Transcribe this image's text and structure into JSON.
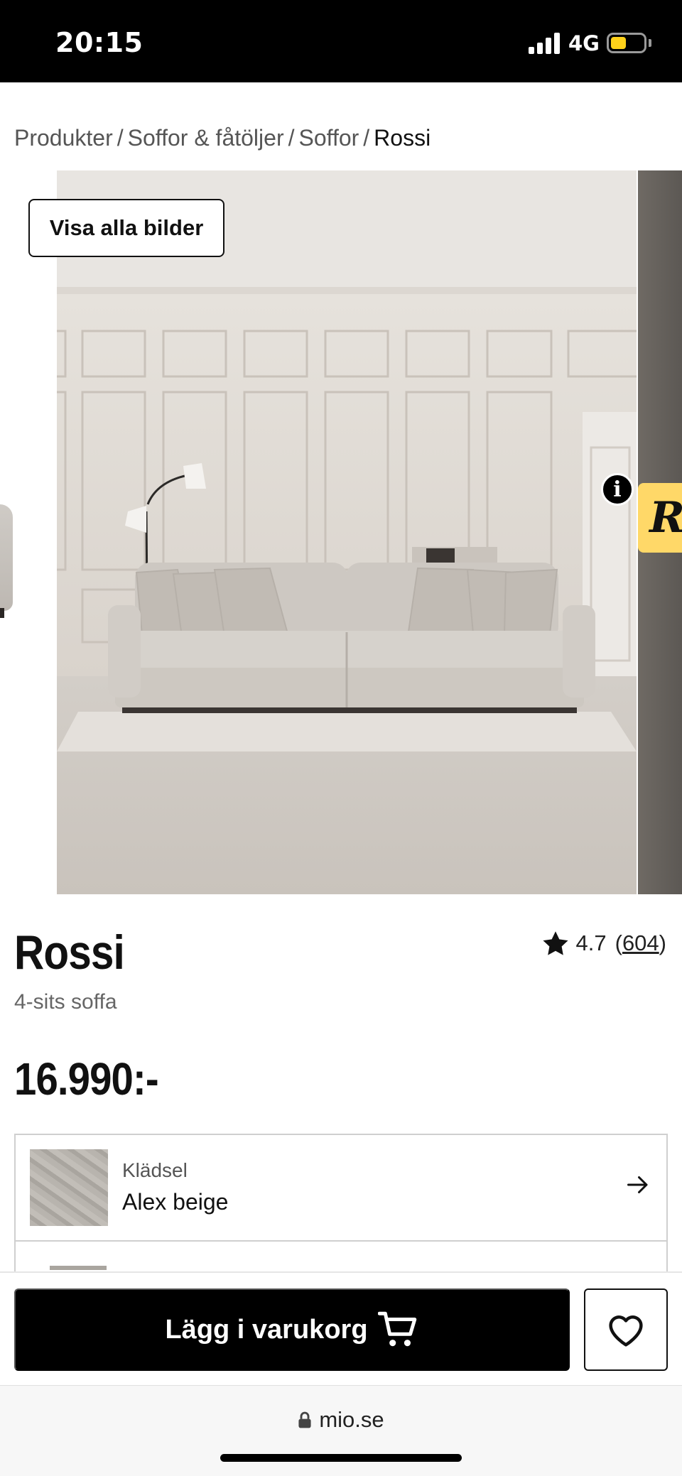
{
  "status": {
    "time": "20:15",
    "network": "4G"
  },
  "breadcrumb": [
    {
      "label": "Produkter"
    },
    {
      "label": "Soffor & fåtöljer"
    },
    {
      "label": "Soffor"
    },
    {
      "label": "Rossi"
    }
  ],
  "breadcrumb_separator": "/",
  "gallery": {
    "show_all_label": "Visa alla bilder",
    "info_badge": "i",
    "chat_badge": "R"
  },
  "product": {
    "name": "Rossi",
    "subtitle": "4-sits soffa",
    "price": "16.990:-",
    "rating": "4.7",
    "review_count_open": "(",
    "review_count": "604",
    "review_count_close": ")"
  },
  "options": [
    {
      "label": "Klädsel",
      "value": "Alex beige"
    }
  ],
  "actions": {
    "add_to_cart": "Lägg i varukorg"
  },
  "browser": {
    "url": "mio.se"
  },
  "colors": {
    "primary": "#000000",
    "badge_yellow": "#ffd868",
    "battery": "#ffd21a"
  }
}
